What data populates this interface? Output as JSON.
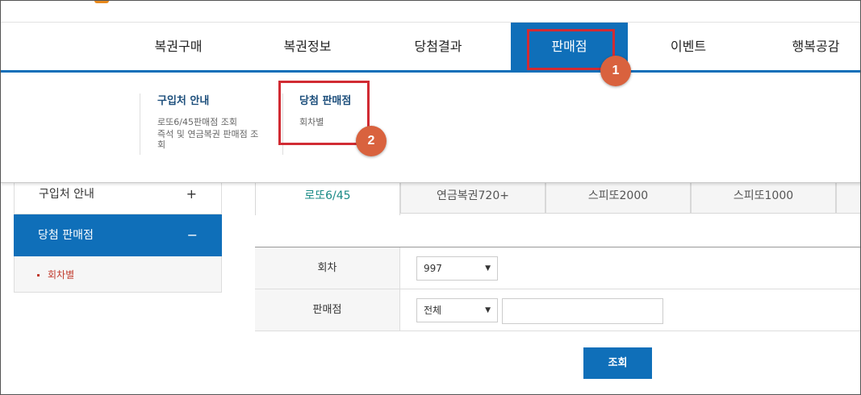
{
  "gnb": {
    "items": [
      "복권구매",
      "복권정보",
      "당첨결과",
      "판매점",
      "이벤트",
      "행복공감"
    ],
    "active_index": 3
  },
  "dropdown": {
    "col1": {
      "title": "구입처 안내",
      "links": [
        "로또6/45판매점 조회",
        "즉석 및 연금복권 판매점 조회"
      ]
    },
    "col2": {
      "title": "당첨 판매점",
      "links": [
        "회차별"
      ]
    }
  },
  "badges": [
    "1",
    "2"
  ],
  "side": {
    "items": [
      {
        "label": "구입처 안내",
        "sign": "+"
      },
      {
        "label": "당첨 판매점",
        "sign": "−"
      }
    ],
    "sub_items": [
      "회차별"
    ]
  },
  "tabs": [
    "로또6/45",
    "연금복권720+",
    "스피또2000",
    "스피또1000"
  ],
  "form": {
    "round_label": "회차",
    "round_value": "997",
    "store_label": "판매점",
    "store_value": "전체",
    "arrow": "▼"
  },
  "search_button": "조회",
  "colors": {
    "primary": "#0f6fb9",
    "highlight": "#d12b33",
    "badge": "#d9623e",
    "active_tab_text": "#1a8a86"
  }
}
